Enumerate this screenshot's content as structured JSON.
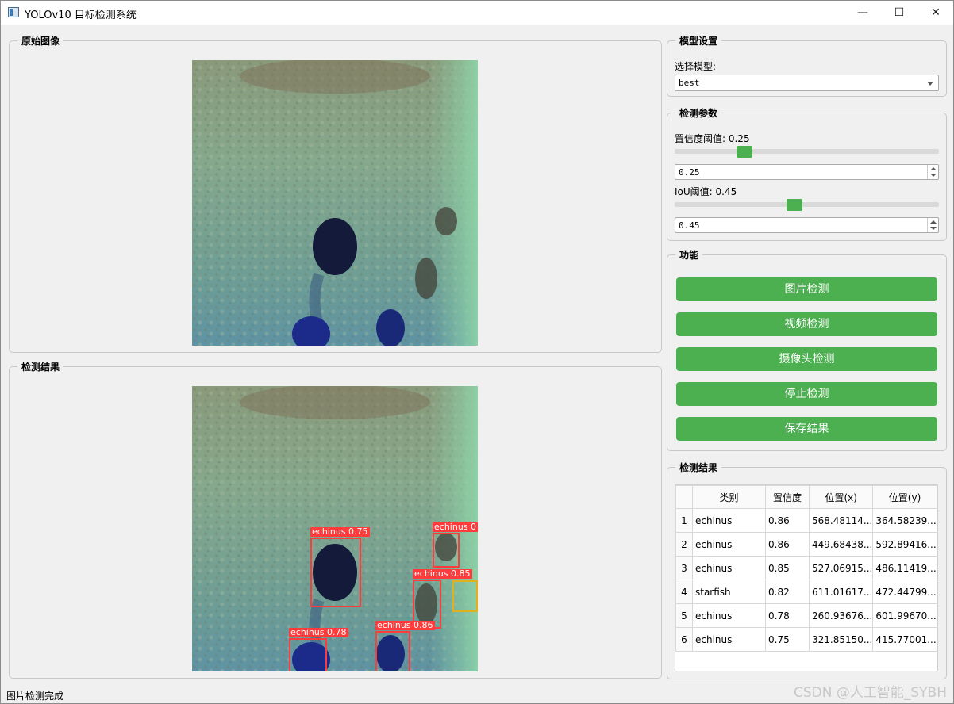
{
  "window": {
    "title": "YOLOv10 目标检测系统",
    "minimize_glyph": "—",
    "maximize_glyph": "☐",
    "close_glyph": "✕"
  },
  "original_panel": {
    "title": "原始图像"
  },
  "result_panel": {
    "title": "检测结果"
  },
  "model_settings": {
    "title": "模型设置",
    "select_label": "选择模型:",
    "selected_model": "best"
  },
  "detect_params": {
    "title": "检测参数",
    "conf_label": "置信度阈值: 0.25",
    "conf_value": "0.25",
    "conf_level": 0.25,
    "iou_label": "IoU阈值: 0.45",
    "iou_value": "0.45",
    "iou_level": 0.45
  },
  "functions": {
    "title": "功能",
    "buttons": [
      "图片检测",
      "视频检测",
      "摄像头检测",
      "停止检测",
      "保存结果"
    ]
  },
  "results_table": {
    "title": "检测结果",
    "headers": [
      "类别",
      "置信度",
      "位置(x)",
      "位置(y)"
    ],
    "rows": [
      {
        "n": "1",
        "cls": "echinus",
        "conf": "0.86",
        "x": "568.48114...",
        "y": "364.58239..."
      },
      {
        "n": "2",
        "cls": "echinus",
        "conf": "0.86",
        "x": "449.68438...",
        "y": "592.89416..."
      },
      {
        "n": "3",
        "cls": "echinus",
        "conf": "0.85",
        "x": "527.06915...",
        "y": "486.11419..."
      },
      {
        "n": "4",
        "cls": "starfish",
        "conf": "0.82",
        "x": "611.01617...",
        "y": "472.44799..."
      },
      {
        "n": "5",
        "cls": "echinus",
        "conf": "0.78",
        "x": "260.93676...",
        "y": "601.99670..."
      },
      {
        "n": "6",
        "cls": "echinus",
        "conf": "0.75",
        "x": "321.85150...",
        "y": "415.77001..."
      }
    ]
  },
  "detections_overlay": [
    {
      "label": "echinus 0.75"
    },
    {
      "label": "echinus 0"
    },
    {
      "label": "echinus 0.85"
    },
    {
      "label": "echinus 0.86"
    },
    {
      "label": "echinus 0.78"
    }
  ],
  "status_bar": {
    "text": "图片检测完成"
  },
  "watermark": "CSDN @人工智能_SYBH"
}
